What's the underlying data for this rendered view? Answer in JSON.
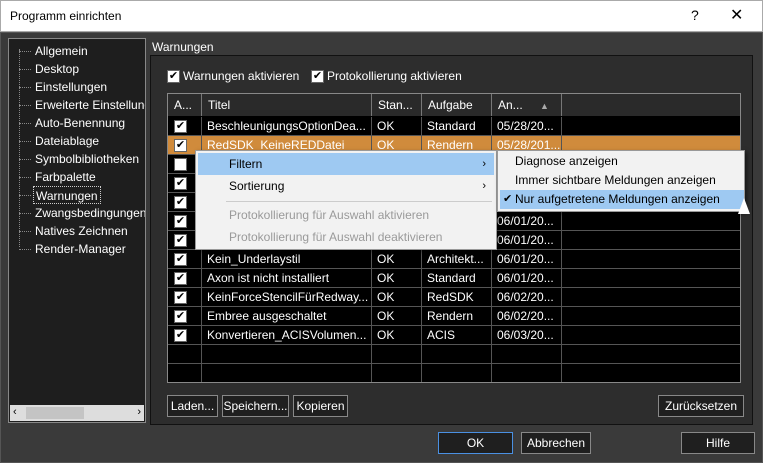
{
  "window": {
    "title": "Programm einrichten",
    "help": "?",
    "close": "✕"
  },
  "tree": {
    "items": [
      "Allgemein",
      "Desktop",
      "Einstellungen",
      "Erweiterte Einstellungen",
      "Auto-Benennung",
      "Dateiablage",
      "Symbolbibliotheken",
      "Farbpalette",
      "Warnungen",
      "Zwangsbedingungen",
      "Natives Zeichnen",
      "Render-Manager"
    ],
    "selected": "Warnungen",
    "scroll_left": "‹",
    "scroll_right": "›"
  },
  "section": {
    "title": "Warnungen"
  },
  "options": {
    "warnings_active": "Warnungen aktivieren",
    "logging_active": "Protokollierung aktivieren"
  },
  "grid": {
    "headers": [
      "A...",
      "Titel",
      "Stan...",
      "Aufgabe",
      "An...",
      "▲"
    ],
    "rows": [
      {
        "title": "BeschleunigungsOptionDea...",
        "status": "OK",
        "task": "Standard",
        "date": "05/28/20...",
        "checked": true
      },
      {
        "title": "RedSDK_KeineREDDatei",
        "status": "OK",
        "task": "Rendern",
        "date": "05/28/201...",
        "checked": true
      },
      {
        "title": "",
        "status": "",
        "task": "",
        "date": "",
        "checked": false
      },
      {
        "title": "",
        "status": "",
        "task": "",
        "date": "",
        "checked": true
      },
      {
        "title": "",
        "status": "",
        "task": "",
        "date": "",
        "checked": true
      },
      {
        "title": "",
        "status": "",
        "task": "",
        "date": "06/01/20...",
        "checked": true
      },
      {
        "title": "",
        "status": "",
        "task": "",
        "date": "06/01/20...",
        "checked": true
      },
      {
        "title": "Kein_Underlaystil",
        "status": "OK",
        "task": "Architekt...",
        "date": "06/01/20...",
        "checked": true
      },
      {
        "title": "Axon ist nicht installiert",
        "status": "OK",
        "task": "Standard",
        "date": "06/01/20...",
        "checked": true
      },
      {
        "title": "KeinForceStencilFürRedway...",
        "status": "OK",
        "task": "RedSDK",
        "date": "06/02/20...",
        "checked": true
      },
      {
        "title": "Embree ausgeschaltet",
        "status": "OK",
        "task": "Rendern",
        "date": "06/02/20...",
        "checked": true
      },
      {
        "title": "Konvertieren_ACISVolumen...",
        "status": "OK",
        "task": "ACIS",
        "date": "06/03/20...",
        "checked": true
      }
    ]
  },
  "context_menu": {
    "filter": "Filtern",
    "sort": "Sortierung",
    "log_on": "Protokollierung für Auswahl aktivieren",
    "log_off": "Protokollierung für Auswahl deaktivieren",
    "arrow": "›"
  },
  "submenu": {
    "items": [
      "Diagnose anzeigen",
      "Immer sichtbare Meldungen anzeigen",
      "Nur aufgetretene Meldungen anzeigen"
    ],
    "checked_mark": "✔"
  },
  "buttons": {
    "load": "Laden...",
    "save": "Speichern...",
    "copy": "Kopieren",
    "reset": "Zurücksetzen",
    "ok": "OK",
    "cancel": "Abbrechen",
    "help": "Hilfe"
  },
  "check_mark": "✔"
}
